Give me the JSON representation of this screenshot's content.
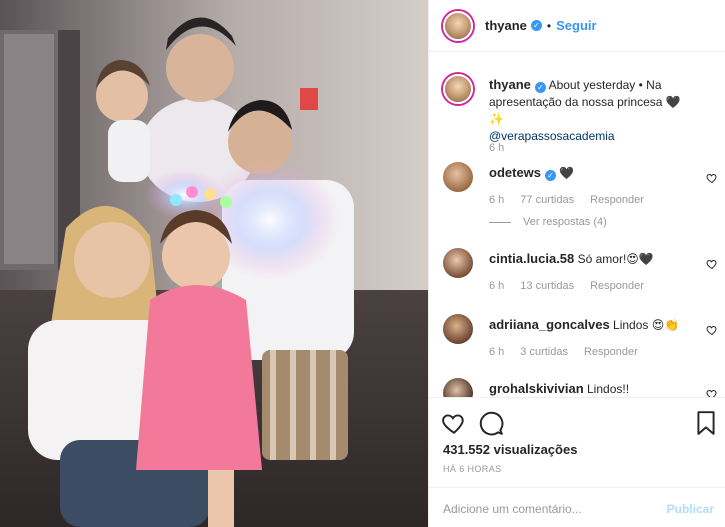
{
  "header": {
    "username": "thyane",
    "follow_label": "Seguir",
    "separator": "•"
  },
  "caption": {
    "username": "thyane",
    "text": "About yesterday • Na apresentação da nossa princesa 🖤✨",
    "mention": "@verapassosacademia",
    "time": "6 h"
  },
  "comments": [
    {
      "username": "odetews",
      "text": "🖤",
      "time": "6 h",
      "likes": "77 curtidas",
      "reply": "Responder",
      "view_replies": "Ver respostas (4)"
    },
    {
      "username": "cintia.lucia.58",
      "text": "Só amor!😍🖤",
      "time": "6 h",
      "likes": "13 curtidas",
      "reply": "Responder"
    },
    {
      "username": "adriiana_goncalves",
      "text": "Lindos 😍👏",
      "time": "6 h",
      "likes": "3 curtidas",
      "reply": "Responder"
    },
    {
      "username": "grohalskivivian",
      "text": "Lindos!!"
    }
  ],
  "actions": {
    "views": "431.552 visualizações",
    "timestamp": "HÁ 6 HORAS"
  },
  "add_comment": {
    "placeholder": "Adicione um comentário...",
    "publish": "Publicar"
  },
  "colors": {
    "link": "#3897f0",
    "verified": "#3897f0",
    "publish_disabled": "#b3dbff",
    "muted": "#999999"
  },
  "icons": [
    "verified-icon",
    "heart-icon",
    "comment-icon",
    "bookmark-icon"
  ]
}
